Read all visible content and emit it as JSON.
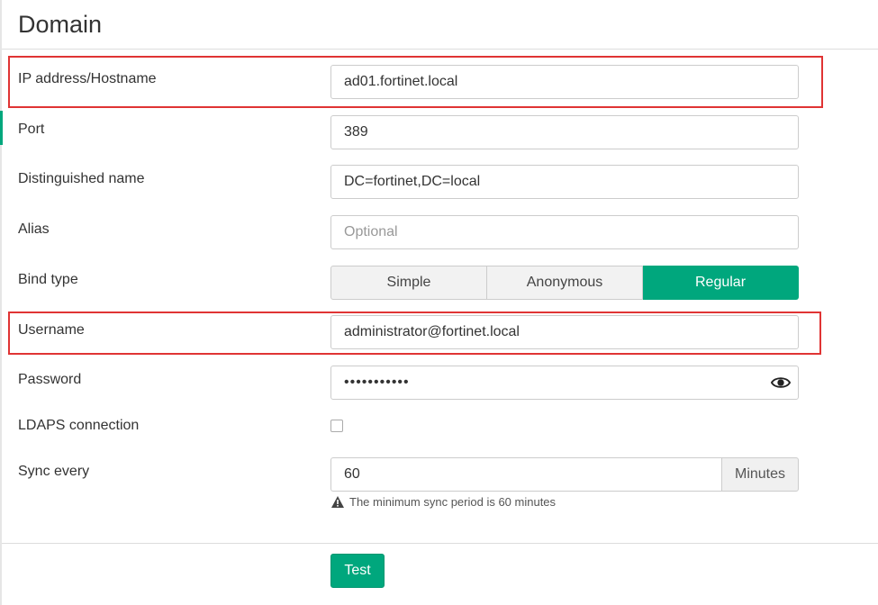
{
  "header": {
    "title": "Domain"
  },
  "form": {
    "ip_hostname": {
      "label": "IP address/Hostname",
      "value": "ad01.fortinet.local"
    },
    "port": {
      "label": "Port",
      "value": "389"
    },
    "distinguished_name": {
      "label": "Distinguished name",
      "value": "DC=fortinet,DC=local"
    },
    "alias": {
      "label": "Alias",
      "value": "",
      "placeholder": "Optional"
    },
    "bind_type": {
      "label": "Bind type",
      "options": [
        "Simple",
        "Anonymous",
        "Regular"
      ],
      "selected": "Regular"
    },
    "username": {
      "label": "Username",
      "value": "administrator@fortinet.local"
    },
    "password": {
      "label": "Password",
      "masked_value": "•••••••••••"
    },
    "ldaps": {
      "label": "LDAPS connection",
      "checked": false
    },
    "sync": {
      "label": "Sync every",
      "value": "60",
      "unit": "Minutes",
      "hint": "The minimum sync period is 60 minutes"
    }
  },
  "actions": {
    "test_label": "Test"
  },
  "colors": {
    "accent": "#00a77d",
    "highlight": "#e03434"
  },
  "icons": {
    "password_toggle": "eye-icon",
    "hint": "warning-icon"
  }
}
